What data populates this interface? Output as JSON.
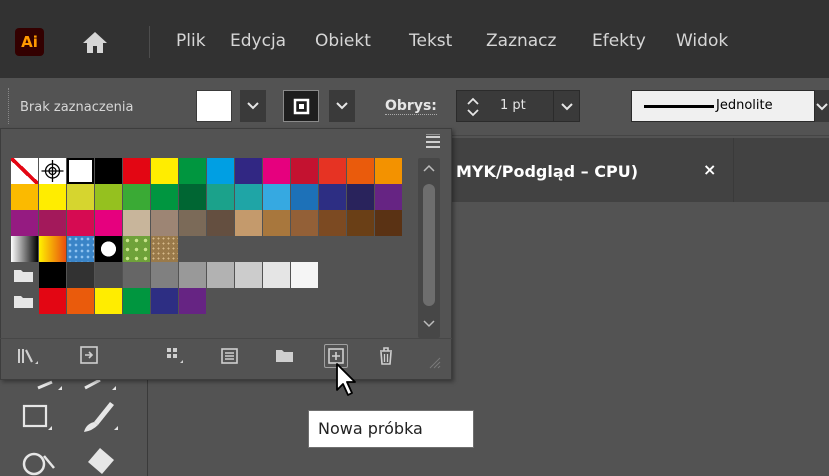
{
  "app": {
    "logo_text": "Ai"
  },
  "menu": {
    "items": [
      "Plik",
      "Edycja",
      "Obiekt",
      "Tekst",
      "Zaznacz",
      "Efekty",
      "Widok"
    ]
  },
  "control_bar": {
    "selection_label": "Brak zaznaczenia",
    "stroke_label": "Obrys:",
    "stroke_weight": "1 pt",
    "stroke_style": "Jednolite"
  },
  "document": {
    "tab_title": "MYK/Podgląd – CPU)",
    "close_symbol": "×"
  },
  "swatches": {
    "rows": [
      [
        "none",
        "registration",
        "#ffffff",
        "#000000",
        "#e30613",
        "#ffed00",
        "#00963f",
        "#009fe3",
        "#312783",
        "#e6007e",
        "#c41230",
        "#e63323",
        "#ea5b0c",
        "#f39200"
      ],
      [
        "#fbba00",
        "#ffed00",
        "#d6d52f",
        "#95c11f",
        "#3aaa35",
        "#009640",
        "#006633",
        "#1ba28b",
        "#1fa5a6",
        "#36a9e1",
        "#1d71b8",
        "#2d2e83",
        "#29235c",
        "#662483"
      ],
      [
        "#951b81",
        "#a3195b",
        "#d60b52",
        "#e6007e",
        "#c8b59b",
        "#9d8574",
        "#7b6a58",
        "#644f40",
        "#c49a6c",
        "#a8773d",
        "#936037",
        "#7c4a22",
        "#6a3f16",
        "#5a3214"
      ],
      [
        "gradient-bw",
        "gradient-orange",
        "pattern-blue",
        "pattern-dots",
        "pattern-leaf",
        "pattern-texture"
      ],
      [
        "folder",
        "#000000",
        "#323232",
        "#4d4d4d",
        "#666666",
        "#808080",
        "#999999",
        "#b2b2b2",
        "#cccccc",
        "#e5e5e5",
        "#f5f5f5"
      ],
      [
        "folder",
        "#e30613",
        "#ea5b0c",
        "#ffed00",
        "#00963f",
        "#2d2e83",
        "#662483"
      ]
    ]
  },
  "panel_buttons": {
    "icons": [
      "swatch-libraries-icon",
      "show-kind-icon",
      "swatch-options-icon",
      "new-color-group-icon",
      "folder-icon",
      "new-swatch-icon",
      "delete-swatch-icon"
    ]
  },
  "tooltip": {
    "text": "Nowa próbka"
  }
}
